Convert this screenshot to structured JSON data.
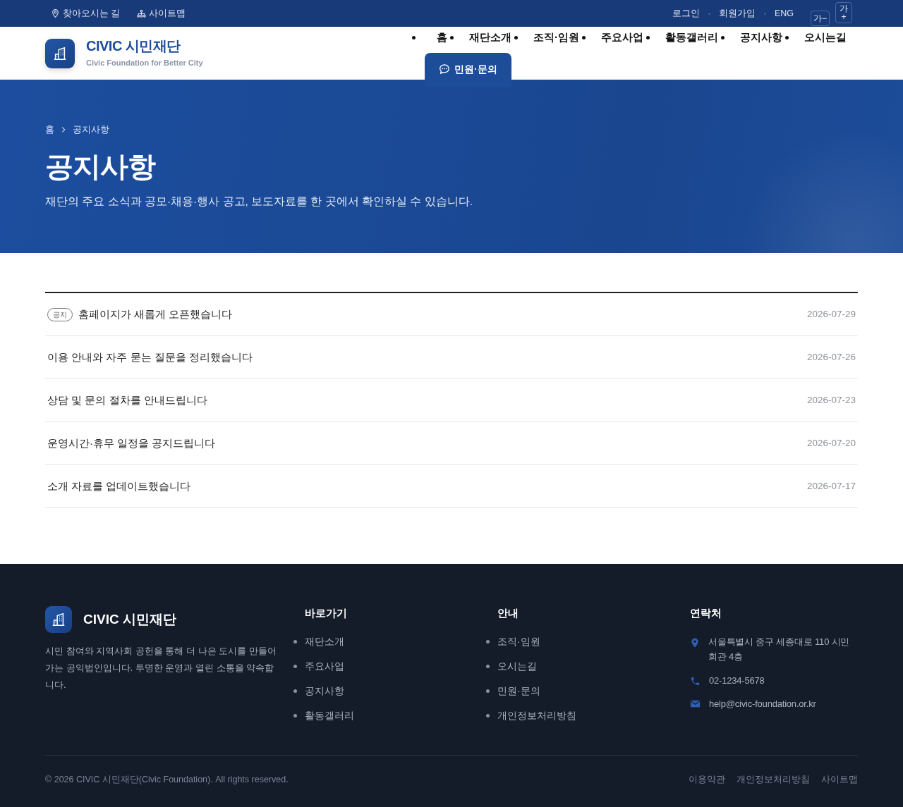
{
  "top_bar": {
    "left_links": [
      {
        "kind": "pin",
        "label": "찾아오시는 길"
      },
      {
        "kind": "sitemap",
        "label": "사이트맵"
      }
    ],
    "right_links": [
      "로그인",
      "회원가입",
      "ENG"
    ],
    "font_buttons": [
      "가−",
      "가+"
    ]
  },
  "header": {
    "logo_title": "CIVIC 시민재단",
    "logo_subtitle": "Civic Foundation for Better City",
    "nav": [
      "홈",
      "재단소개",
      "조직·임원",
      "주요사업",
      "활동갤러리",
      "공지사항",
      "오시는길"
    ],
    "cta": "민원·문의"
  },
  "hero": {
    "breadcrumb": [
      "홈",
      "공지사항"
    ],
    "title": "공지사항",
    "subtitle": "재단의 주요 소식과 공모·채용·행사 공고, 보도자료를 한 곳에서 확인하실 수 있습니다."
  },
  "notices": [
    {
      "badge": "공지",
      "title": "홈페이지가 새롭게 오픈했습니다",
      "date": "2026-07-29"
    },
    {
      "title": "이용 안내와 자주 묻는 질문을 정리했습니다",
      "date": "2026-07-26"
    },
    {
      "title": "상담 및 문의 절차를 안내드립니다",
      "date": "2026-07-23"
    },
    {
      "title": "운영시간·휴무 일정을 공지드립니다",
      "date": "2026-07-20"
    },
    {
      "title": "소개 자료를 업데이트했습니다",
      "date": "2026-07-17"
    }
  ],
  "footer": {
    "logo_title": "CIVIC 시민재단",
    "description": "시민 참여와 지역사회 공헌을 통해 더 나은 도시를 만들어가는 공익법인입니다. 투명한 운영과 열린 소통을 약속합니다.",
    "columns": [
      {
        "heading": "바로가기",
        "links": [
          "재단소개",
          "주요사업",
          "공지사항",
          "활동갤러리"
        ]
      },
      {
        "heading": "안내",
        "links": [
          "조직·임원",
          "오시는길",
          "민원·문의",
          "개인정보처리방침"
        ]
      }
    ],
    "contact": {
      "heading": "연락처",
      "items": [
        {
          "kind": "address",
          "text": "서울특별시 중구 세종대로 110 시민회관 4층"
        },
        {
          "kind": "phone",
          "text": "02-1234-5678"
        },
        {
          "kind": "email",
          "text": "help@civic-foundation.or.kr"
        }
      ]
    },
    "copyright": "© 2026 CIVIC 시민재단(Civic Foundation). All rights reserved.",
    "bottom_links": [
      "이용약관",
      "개인정보처리방침",
      "사이트맵"
    ]
  }
}
